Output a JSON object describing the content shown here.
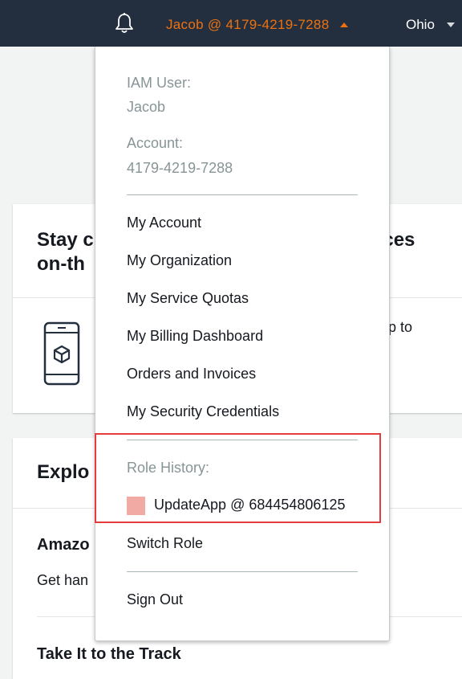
{
  "topbar": {
    "account_label": "Jacob @ 4179-4219-7288",
    "region_label": "Ohio",
    "bell_icon": "notification-bell-icon",
    "colors": {
      "background": "#232f3e",
      "account_accent": "#ec7211",
      "region_text": "#ffffff"
    }
  },
  "background": {
    "card1": {
      "title_left": "Stay c",
      "title_right": "rces",
      "title_line2": "on-th",
      "body_right": "pp to",
      "icon": "mobile-phone-cube-icon"
    },
    "card2": {
      "title": "Explo",
      "item1_title": "Amazo",
      "item1_text": "Get han",
      "item2_title": "Take It to the Track"
    }
  },
  "dropdown": {
    "iam_user_label": "IAM User:",
    "iam_user_value": "Jacob",
    "account_label": "Account:",
    "account_value": "4179-4219-7288",
    "items": [
      "My Account",
      "My Organization",
      "My Service Quotas",
      "My Billing Dashboard",
      "Orders and Invoices",
      "My Security Credentials"
    ],
    "role_history_label": "Role History:",
    "role_history_entry": "UpdateApp @ 684454806125",
    "role_color": "#f2aaa5",
    "switch_role": "Switch Role",
    "sign_out": "Sign Out",
    "highlight_color": "#e33d3d"
  }
}
